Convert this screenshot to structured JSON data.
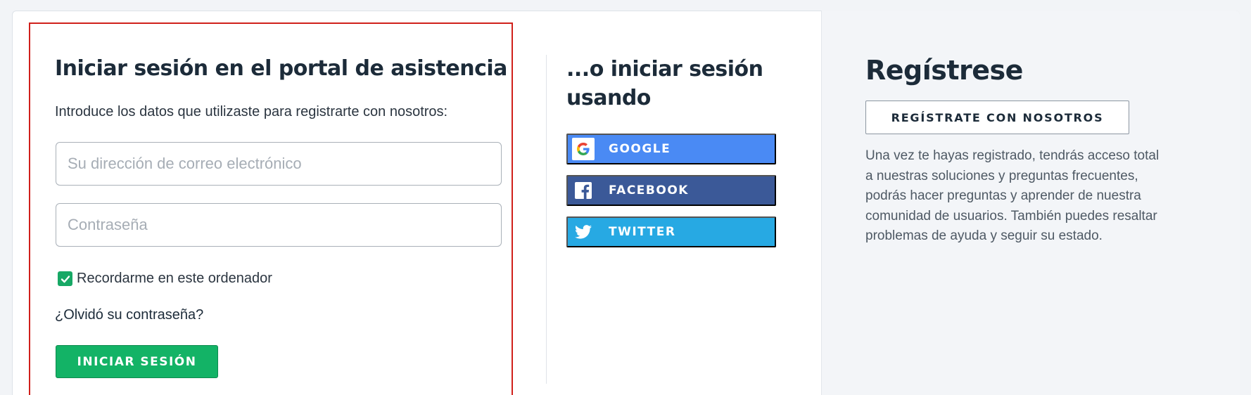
{
  "login": {
    "title": "Iniciar sesión en el portal de asistencia",
    "description": "Introduce los datos que utilizaste para registrarte con nosotros:",
    "email_placeholder": "Su dirección de correo electrónico",
    "email_value": "",
    "password_placeholder": "Contraseña",
    "password_value": "",
    "remember_label": "Recordarme en este ordenador",
    "remember_checked": true,
    "forgot_label": "¿Olvidó su contraseña?",
    "submit_label": "INICIAR SESIÓN"
  },
  "social": {
    "title": "...o iniciar sesión usando",
    "buttons": [
      {
        "label": "GOOGLE",
        "icon": "google-icon",
        "color": "#4a8af4"
      },
      {
        "label": "FACEBOOK",
        "icon": "facebook-icon",
        "color": "#3b5998"
      },
      {
        "label": "TWITTER",
        "icon": "twitter-icon",
        "color": "#27a9e3"
      }
    ]
  },
  "register": {
    "title": "Regístrese",
    "button_label": "REGÍSTRATE CON NOSOTROS",
    "description": "Una vez te hayas registrado, tendrás acceso total a nuestras soluciones y preguntas frecuentes, podrás hacer preguntas y aprender de nuestra comunidad de usuarios. También puedes resaltar problemas de ayuda y seguir su estado."
  },
  "colors": {
    "accent_green": "#13b366",
    "highlight_border": "#d0201b",
    "text_dark": "#1c2b39"
  }
}
